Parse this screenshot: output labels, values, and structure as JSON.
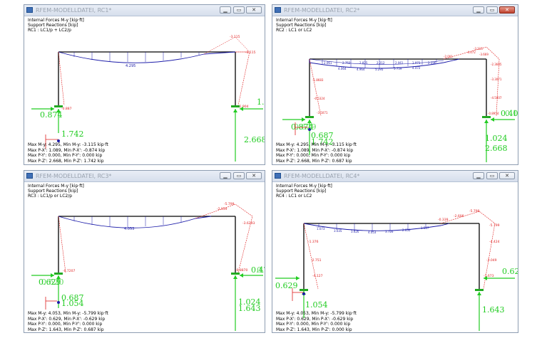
{
  "colors": {
    "structure": "#000000",
    "moment": "#1a1aa8",
    "moment_red": "#e02020",
    "reaction": "#22cc22",
    "title_inactive": "#9aa3b0"
  },
  "controls": {
    "minimize": "▁",
    "maximize": "▭",
    "close": "✕"
  },
  "windows": [
    {
      "title": "RFEM-MODELLDATEI, RC1*",
      "info": [
        "Internal Forces M-y [kip·ft]",
        "Support Reactions [kip]",
        "RC1 : LC1/p + LC2/p"
      ],
      "moment_labels": {
        "mid": "4.295",
        "top_right": "-3.115",
        "right_col": "-3.115",
        "left_base": "-0.887",
        "right_base": "-1.904"
      },
      "reactions": {
        "left_h": "0.874",
        "right_h": "1.0",
        "left_v": "1.742",
        "right_v": "2.668"
      },
      "summary": [
        "Max M-y: 4.295, Min M-y: -3.115 kip·ft",
        "Max P-X': 1.089, Min P-X': -0.874 kip",
        "Max P-Y': 0.000, Min P-Y': 0.000 kip",
        "Max P-Z': 2.668, Min P-Z': 1.742 kip"
      ]
    },
    {
      "title": "RFEM-MODELLDATEI, RC2*",
      "info": [
        "Internal Forces M-y [kip·ft]",
        "Support Reactions [kip]",
        "RC2 : LC1 or LC2"
      ],
      "moment_labels": {
        "row1": [
          "2.061",
          "2.752",
          "2.825",
          "2.212",
          "2.061",
          "1.973",
          "2.596"
        ],
        "row2": [
          "4.064",
          "4.964",
          "5.295",
          "5.759",
          "4.472"
        ],
        "right_top": [
          "-3.115",
          "-4.472",
          "-3.669",
          "-2.001"
        ],
        "left_col": [
          "-1.8683",
          "-0.5324",
          "-3.5071"
        ],
        "right_col": [
          "-2.3605",
          "-3.3071",
          "-4.5007",
          "-0.8954"
        ]
      },
      "reactions": {
        "left_h": "0.874",
        "left_h2": "0.629",
        "right_h": "0.40",
        "right_h2": "0.1",
        "left_v": "0.687",
        "left_v2": "1.742",
        "right_v": "1.024",
        "right_v2": "2.668"
      },
      "summary": [
        "Max M-y: 4.295, Min M-y: -3.115 kip·ft",
        "Max P-X': 1.089, Min P-X': -0.874 kip",
        "Max P-Y': 0.000, Min P-Y': 0.000 kip",
        "Max P-Z': 2.668, Min P-Z': 0.687 kip"
      ]
    },
    {
      "title": "RFEM-MODELLDATEI, RC3*",
      "info": [
        "Internal Forces M-y [kip·ft]",
        "Support Reactions [kip]",
        "RC3 : LC1/p or LC2/p"
      ],
      "moment_labels": {
        "mid": "4.053",
        "top_right": "-5.799",
        "top_right2": "-2.959",
        "right_col": "-3.6293",
        "left_base": "-0.7207",
        "right_base": "-0.8870"
      },
      "reactions": {
        "left_h": "0.629",
        "left_h2": "0.620",
        "right_h": "0.47",
        "right_h2": "0.3",
        "left_v": "0.687",
        "left_v2": "1.054",
        "right_v": "1.024",
        "right_v2": "1.643"
      },
      "summary": [
        "Max M-y: 4.053, Min M-y: -5.799 kip·ft",
        "Max P-X': 0.629, Min P-X': -0.629 kip",
        "Max P-Y': 0.000, Min P-Y': 0.000 kip",
        "Max P-Z': 1.643, Min P-Z': 0.687 kip"
      ]
    },
    {
      "title": "RFEM-MODELLDATEI, RC4*",
      "info": [
        "Internal Forces M-y [kip·ft]",
        "Support Reactions [kip]",
        "RC4 : LC1 or LC2"
      ],
      "moment_labels": {
        "row": [
          "1.073",
          "3.035",
          "3.626",
          "4.053",
          "3.726",
          "2.650",
          "1.507"
        ],
        "top_right": [
          "-5.799",
          "-2.606",
          "-0.339"
        ],
        "right_col": [
          "-5.799",
          "-4.424",
          "-3.049",
          "-1.673"
        ],
        "left_col": [
          "-1.376",
          "-2.751",
          "-4.127"
        ]
      },
      "reactions": {
        "left_h": "0.629",
        "right_h": "0.62",
        "left_v": "1.054",
        "right_v": "1.643"
      },
      "summary": [
        "Max M-y: 4.053, Min M-y: -5.799 kip·ft",
        "Max P-X': 0.629, Min P-X': -0.629 kip",
        "Max P-Y': 0.000, Min P-Y': 0.000 kip",
        "Max P-Z': 1.643, Min P-Z': 0.000 kip"
      ]
    }
  ]
}
